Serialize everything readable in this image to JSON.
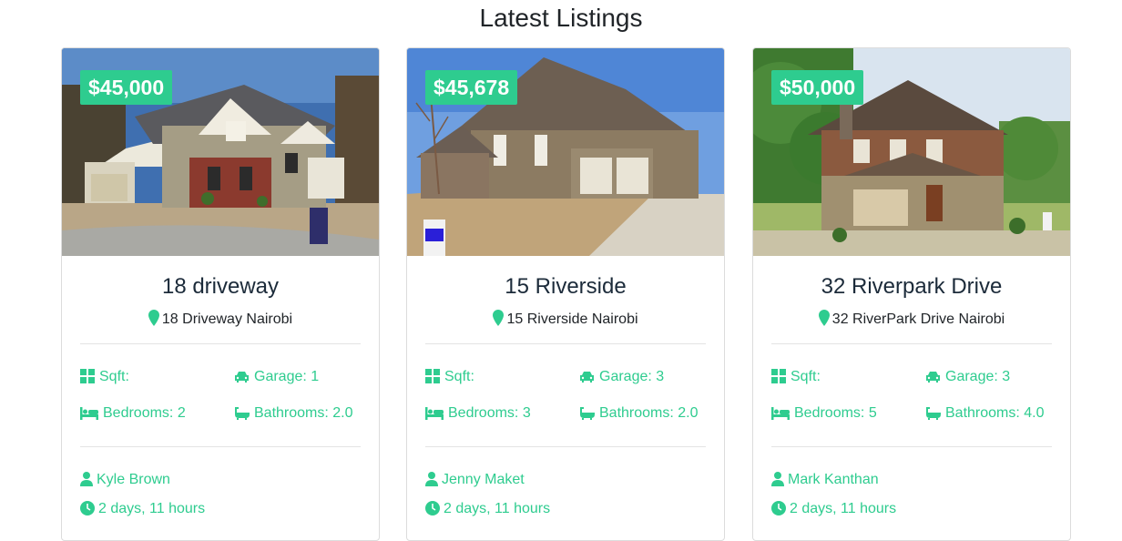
{
  "page": {
    "title": "Latest Listings"
  },
  "colors": {
    "accent": "#2ecc8f",
    "heading": "#1c2b3a"
  },
  "listings": [
    {
      "price": "$45,000",
      "name": "18 driveway",
      "address": "18 Driveway Nairobi",
      "sqft_label": "Sqft:",
      "garage_label": "Garage: 1",
      "bedrooms_label": "Bedrooms: 2",
      "bathrooms_label": "Bathrooms: 2.0",
      "realtor": "Kyle Brown",
      "listed": "2 days, 11 hours",
      "photo": "house-photo"
    },
    {
      "price": "$45,678",
      "name": "15 Riverside",
      "address": "15 Riverside Nairobi",
      "sqft_label": "Sqft:",
      "garage_label": "Garage: 3",
      "bedrooms_label": "Bedrooms: 3",
      "bathrooms_label": "Bathrooms: 2.0",
      "realtor": "Jenny Maket",
      "listed": "2 days, 11 hours",
      "photo": "house-photo"
    },
    {
      "price": "$50,000",
      "name": "32 Riverpark Drive",
      "address": "32 RiverPark Drive Nairobi",
      "sqft_label": "Sqft:",
      "garage_label": "Garage: 3",
      "bedrooms_label": "Bedrooms: 5",
      "bathrooms_label": "Bathrooms: 4.0",
      "realtor": "Mark Kanthan",
      "listed": "2 days, 11 hours",
      "photo": "house-photo"
    }
  ]
}
